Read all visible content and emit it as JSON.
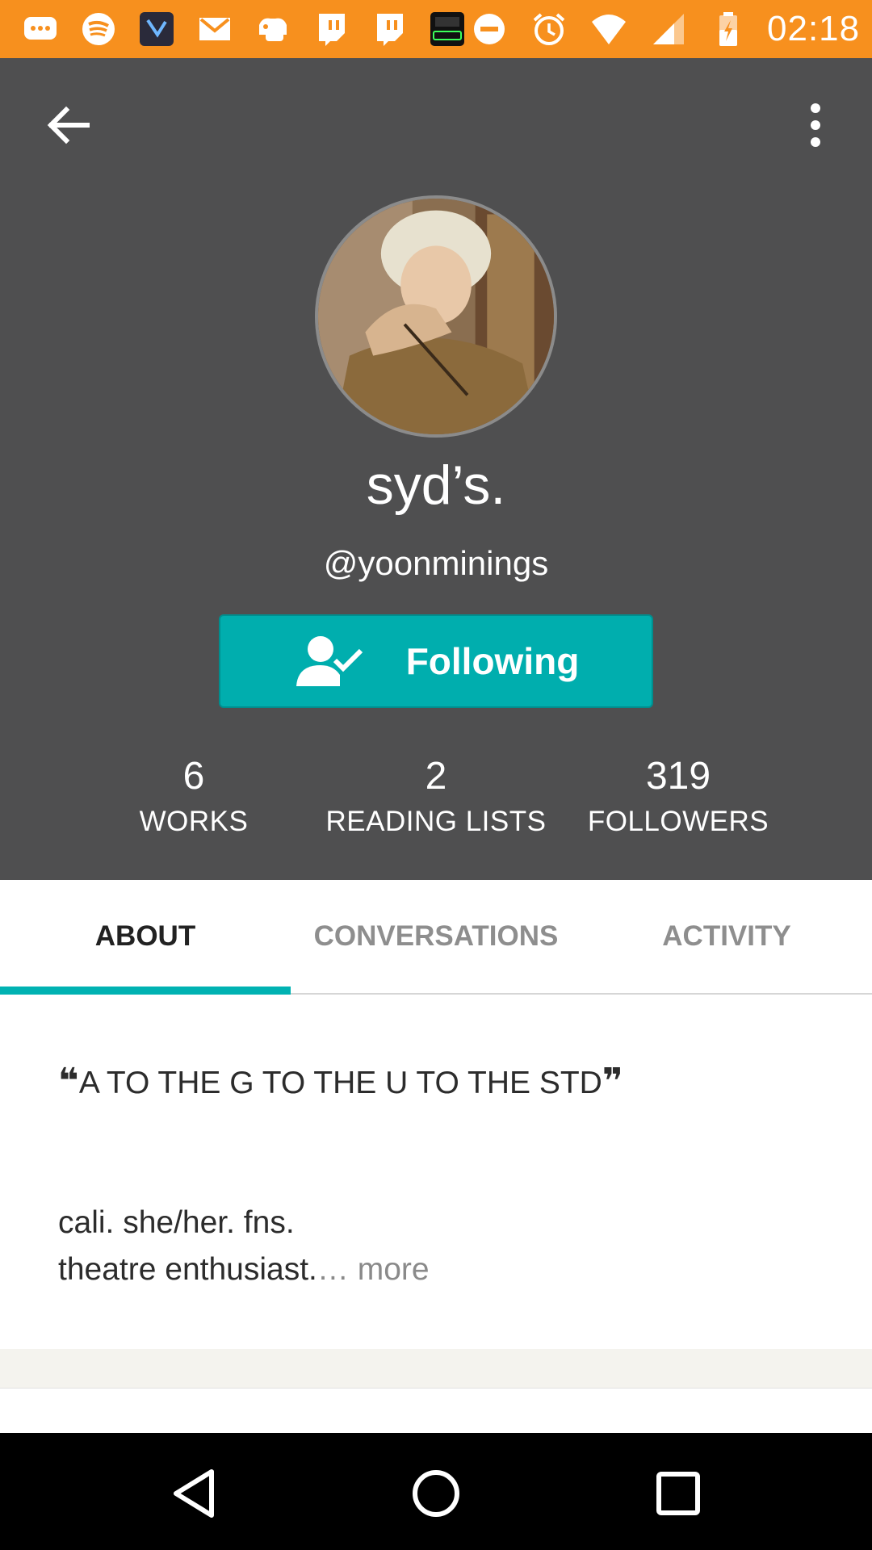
{
  "status_bar": {
    "time": "02:18",
    "notification_icons": [
      "chat-bubble-icon",
      "spotify-icon",
      "app-icon",
      "gmail-icon",
      "game-controller-icon",
      "twitch-icon",
      "twitch-icon",
      "open-sign-icon"
    ],
    "system_icons": [
      "do-not-disturb-icon",
      "alarm-icon",
      "wifi-icon",
      "cell-signal-icon",
      "battery-charging-icon"
    ],
    "bar_color": "#f7901e"
  },
  "header": {
    "background": "#4f4f50",
    "display_name": "syd’s.",
    "username": "@yoonminings",
    "follow_button_label": "Following",
    "follow_button_color": "#00aeae"
  },
  "stats": [
    {
      "value": "6",
      "label": "WORKS"
    },
    {
      "value": "2",
      "label": "READING LISTS"
    },
    {
      "value": "319",
      "label": "FOLLOWERS"
    }
  ],
  "tabs": [
    {
      "label": "ABOUT",
      "active": true
    },
    {
      "label": "CONVERSATIONS",
      "active": false
    },
    {
      "label": "ACTIVITY",
      "active": false
    }
  ],
  "accent_color": "#00b2b2",
  "about": {
    "quote_open": "❝",
    "quote_text": "A TO THE G TO THE U TO THE STD",
    "quote_close": "❞",
    "desc_line1": "cali. she/her. fns.",
    "desc_line2": "theatre enthusiast.",
    "ellipsis": "… ",
    "more_label": "more"
  }
}
